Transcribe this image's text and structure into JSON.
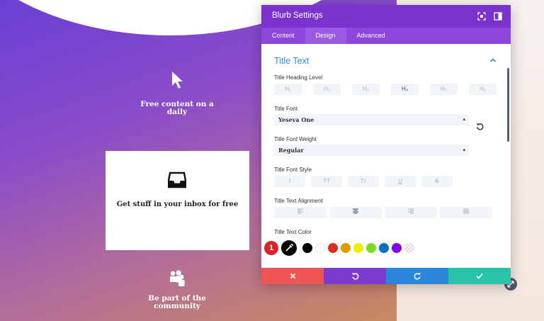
{
  "background": {
    "features": [
      {
        "label": "Free content on a daily"
      },
      {
        "label": "Get stuff in your inbox for free"
      },
      {
        "label": "Be part of the community"
      }
    ]
  },
  "modal": {
    "title": "Blurb Settings",
    "tabs": [
      {
        "label": "Content",
        "active": false
      },
      {
        "label": "Design",
        "active": true
      },
      {
        "label": "Advanced",
        "active": false
      }
    ],
    "section_title": "Title Text",
    "heading_level": {
      "label": "Title Heading Level",
      "options": [
        "H₁",
        "H₂",
        "H₃",
        "H₄",
        "H₅",
        "H₆"
      ],
      "selected": "H₄"
    },
    "font": {
      "label": "Title Font",
      "value": "Yeseva One"
    },
    "font_weight": {
      "label": "Title Font Weight",
      "value": "Regular"
    },
    "font_style": {
      "label": "Title Font Style",
      "options": [
        "I",
        "TT",
        "Tᴛ",
        "U",
        "S"
      ]
    },
    "alignment": {
      "label": "Title Text Alignment",
      "selected_index": 1
    },
    "text_color": {
      "label": "Title Text Color",
      "badge": "1",
      "swatches": [
        "#000000",
        "#ffffff",
        "#e02b20",
        "#e09900",
        "#edf000",
        "#7cda24",
        "#0c71c3",
        "#8300e9",
        "transparent"
      ]
    },
    "footer_colors": [
      "#ef5555",
      "#7d3bcf",
      "#2b87da",
      "#29c4a9"
    ]
  }
}
